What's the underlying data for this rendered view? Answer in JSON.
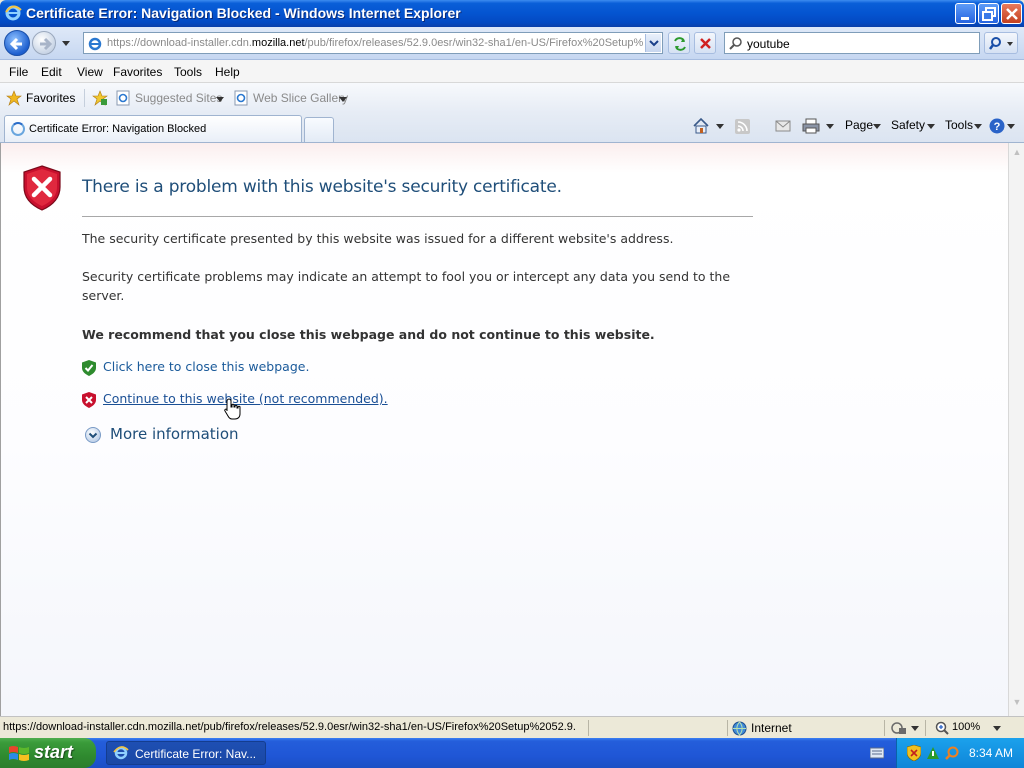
{
  "window": {
    "title": "Certificate Error: Navigation Blocked - Windows Internet Explorer"
  },
  "address": {
    "url_prefix": "https://download-installer.cdn.",
    "url_domain": "mozilla.net",
    "url_suffix": "/pub/firefox/releases/52.9.0esr/win32-sha1/en-US/Firefox%20Setup%"
  },
  "search": {
    "value": "youtube"
  },
  "menu": {
    "items": [
      "File",
      "Edit",
      "View",
      "Favorites",
      "Tools",
      "Help"
    ]
  },
  "favorites_bar": {
    "favorites_label": "Favorites",
    "suggested_sites": "Suggested Sites",
    "web_slice_gallery": "Web Slice Gallery"
  },
  "tab": {
    "label": "Certificate Error: Navigation Blocked"
  },
  "command_bar": {
    "page": "Page",
    "safety": "Safety",
    "tools": "Tools"
  },
  "content": {
    "heading": "There is a problem with this website's security certificate.",
    "para1": "The security certificate presented by this website was issued for a different website's address.",
    "para2": "Security certificate problems may indicate an attempt to fool you or intercept any data you send to the server.",
    "recommend": "We recommend that you close this webpage and do not continue to this website.",
    "close_link": "Click here to close this webpage.",
    "continue_link": "Continue to this website (not recommended).",
    "more_info": "More information"
  },
  "statusbar": {
    "url": "https://download-installer.cdn.mozilla.net/pub/firefox/releases/52.9.0esr/win32-sha1/en-US/Firefox%20Setup%2052.9.",
    "zone": "Internet",
    "zoom": "100%"
  },
  "taskbar": {
    "start": "start",
    "task_item": "Certificate Error: Nav...",
    "clock": "8:34 AM"
  },
  "colors": {
    "titlebar": "#0454d0",
    "heading": "#1f4e79",
    "link": "#1a5a9a",
    "error_red": "#c8102e",
    "safe_green": "#3a9b3a"
  }
}
